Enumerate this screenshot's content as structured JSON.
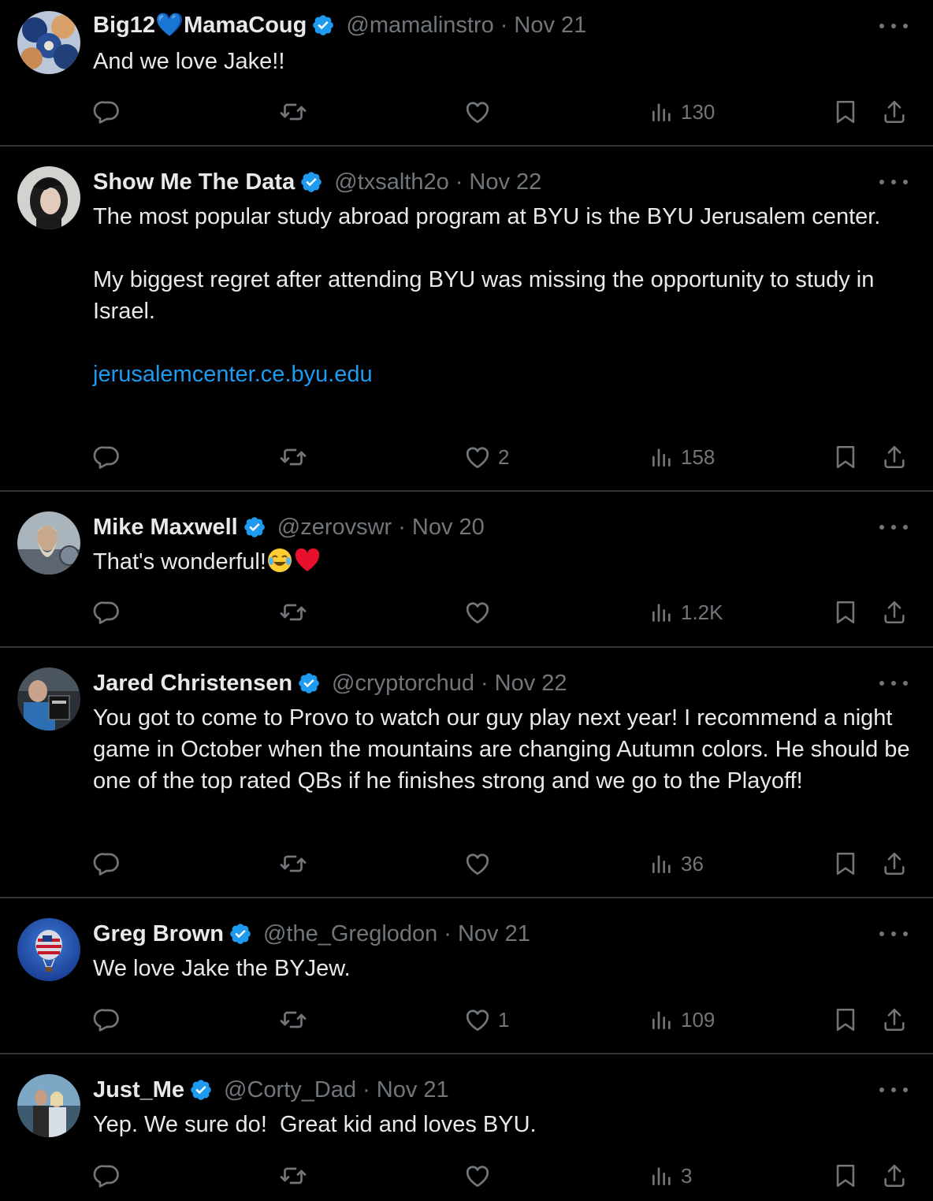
{
  "tweets": [
    {
      "name": "Big12💙MamaCoug",
      "handle": "@mamalinstro",
      "sep": "·",
      "date": "Nov 21",
      "text": "And we love Jake!!",
      "likes": "",
      "views": "130",
      "avatar_icon": "cougars-collage-avatar"
    },
    {
      "name": "Show Me The Data",
      "handle": "@txsalth2o",
      "sep": "·",
      "date": "Nov 22",
      "text": "The most popular study abroad program at BYU is the BYU Jerusalem center.\n\nMy biggest regret after attending BYU was missing the opportunity to study in Israel.\n\n",
      "link": "jerusalemcenter.ce.byu.edu",
      "likes": "2",
      "views": "158",
      "avatar_icon": "woman-portrait-avatar"
    },
    {
      "name": "Mike Maxwell",
      "handle": "@zerovswr",
      "sep": "·",
      "date": "Nov 20",
      "text": "That's wonderful!",
      "emojis": [
        "tears-of-joy-emoji",
        "red-heart-emoji"
      ],
      "likes": "",
      "views": "1.2K",
      "avatar_icon": "viking-warrior-avatar"
    },
    {
      "name": "Jared Christensen",
      "handle": "@cryptorchud",
      "sep": "·",
      "date": "Nov 22",
      "text": "You got to come to Provo to watch our guy play next year! I recommend a night game in October when the mountains are changing Autumn colors. He should be one of the top rated QBs if he finishes strong and we go to the Playoff!",
      "likes": "",
      "views": "36",
      "avatar_icon": "man-holding-book-avatar"
    },
    {
      "name": "Greg Brown",
      "handle": "@the_Greglodon",
      "sep": "·",
      "date": "Nov 21",
      "text": "We love Jake the BYJew.",
      "likes": "1",
      "views": "109",
      "avatar_icon": "hot-air-balloon-avatar"
    },
    {
      "name": "Just_Me",
      "handle": "@Corty_Dad",
      "sep": "·",
      "date": "Nov 21",
      "text": "Yep. We sure do!  Great kid and loves BYU.",
      "likes": "",
      "views": "3",
      "avatar_icon": "couple-photo-avatar"
    }
  ],
  "colors": {
    "background": "#000000",
    "text": "#e7e9ea",
    "muted": "#71767b",
    "link": "#1d9bf0",
    "verified": "#1d9bf0",
    "divider": "#2f3336"
  }
}
